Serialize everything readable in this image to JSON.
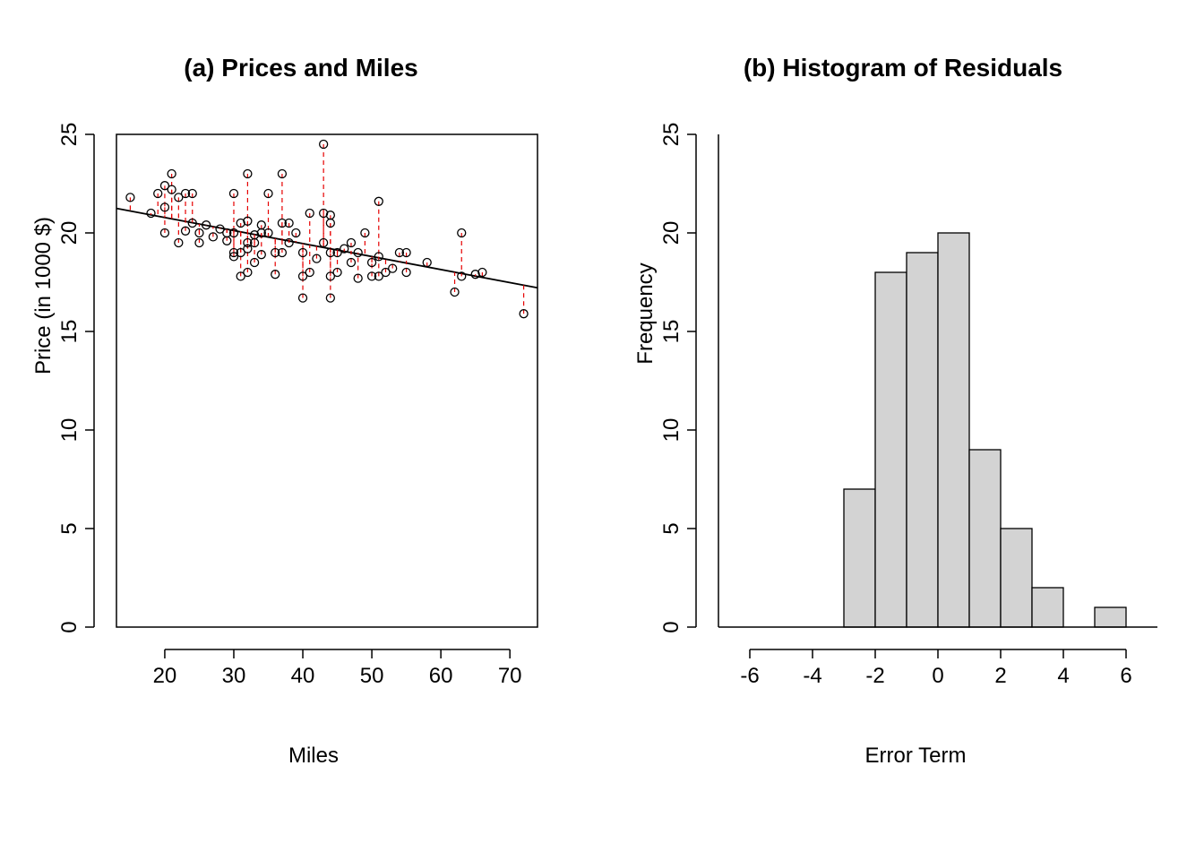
{
  "chart_data": [
    {
      "type": "scatter",
      "title": "(a) Prices and Miles",
      "xlabel": "Miles",
      "ylabel": "Price (in 1000 $)",
      "xlim": [
        13,
        74
      ],
      "ylim": [
        0,
        25
      ],
      "xticks": [
        20,
        30,
        40,
        50,
        60,
        70
      ],
      "yticks": [
        0,
        5,
        10,
        15,
        20,
        25
      ],
      "regression": {
        "slope": -0.066,
        "intercept": 22.1
      },
      "points": [
        {
          "x": 15,
          "y": 21.8
        },
        {
          "x": 18,
          "y": 21.0
        },
        {
          "x": 19,
          "y": 22.0
        },
        {
          "x": 20,
          "y": 22.4
        },
        {
          "x": 20,
          "y": 21.3
        },
        {
          "x": 20,
          "y": 20.0
        },
        {
          "x": 21,
          "y": 23.0
        },
        {
          "x": 21,
          "y": 22.2
        },
        {
          "x": 22,
          "y": 21.8
        },
        {
          "x": 22,
          "y": 19.5
        },
        {
          "x": 23,
          "y": 20.1
        },
        {
          "x": 23,
          "y": 22.0
        },
        {
          "x": 24,
          "y": 20.5
        },
        {
          "x": 24,
          "y": 22.0
        },
        {
          "x": 25,
          "y": 19.5
        },
        {
          "x": 25,
          "y": 20.0
        },
        {
          "x": 26,
          "y": 20.4
        },
        {
          "x": 27,
          "y": 19.8
        },
        {
          "x": 28,
          "y": 20.2
        },
        {
          "x": 29,
          "y": 19.6
        },
        {
          "x": 29,
          "y": 20.0
        },
        {
          "x": 30,
          "y": 18.8
        },
        {
          "x": 30,
          "y": 19.0
        },
        {
          "x": 30,
          "y": 20.0
        },
        {
          "x": 30,
          "y": 22.0
        },
        {
          "x": 31,
          "y": 17.8
        },
        {
          "x": 31,
          "y": 19.0
        },
        {
          "x": 31,
          "y": 20.5
        },
        {
          "x": 32,
          "y": 18.0
        },
        {
          "x": 32,
          "y": 19.2
        },
        {
          "x": 32,
          "y": 19.5
        },
        {
          "x": 32,
          "y": 20.6
        },
        {
          "x": 32,
          "y": 23.0
        },
        {
          "x": 33,
          "y": 18.5
        },
        {
          "x": 33,
          "y": 19.5
        },
        {
          "x": 33,
          "y": 19.9
        },
        {
          "x": 34,
          "y": 18.9
        },
        {
          "x": 34,
          "y": 20.0
        },
        {
          "x": 34,
          "y": 20.4
        },
        {
          "x": 35,
          "y": 20.0
        },
        {
          "x": 35,
          "y": 22.0
        },
        {
          "x": 36,
          "y": 19.0
        },
        {
          "x": 36,
          "y": 17.9
        },
        {
          "x": 37,
          "y": 23.0
        },
        {
          "x": 37,
          "y": 20.5
        },
        {
          "x": 37,
          "y": 19.0
        },
        {
          "x": 38,
          "y": 19.5
        },
        {
          "x": 38,
          "y": 20.5
        },
        {
          "x": 39,
          "y": 20.0
        },
        {
          "x": 40,
          "y": 16.7
        },
        {
          "x": 40,
          "y": 17.8
        },
        {
          "x": 40,
          "y": 19.0
        },
        {
          "x": 41,
          "y": 18.0
        },
        {
          "x": 41,
          "y": 21.0
        },
        {
          "x": 42,
          "y": 18.7
        },
        {
          "x": 43,
          "y": 19.5
        },
        {
          "x": 43,
          "y": 21.0
        },
        {
          "x": 43,
          "y": 24.5
        },
        {
          "x": 44,
          "y": 16.7
        },
        {
          "x": 44,
          "y": 17.8
        },
        {
          "x": 44,
          "y": 19.0
        },
        {
          "x": 44,
          "y": 20.5
        },
        {
          "x": 44,
          "y": 20.9
        },
        {
          "x": 45,
          "y": 18.0
        },
        {
          "x": 45,
          "y": 19.0
        },
        {
          "x": 46,
          "y": 19.2
        },
        {
          "x": 47,
          "y": 18.5
        },
        {
          "x": 47,
          "y": 19.5
        },
        {
          "x": 48,
          "y": 17.7
        },
        {
          "x": 48,
          "y": 19.0
        },
        {
          "x": 49,
          "y": 20.0
        },
        {
          "x": 50,
          "y": 17.8
        },
        {
          "x": 50,
          "y": 18.5
        },
        {
          "x": 51,
          "y": 17.8
        },
        {
          "x": 51,
          "y": 18.8
        },
        {
          "x": 51,
          "y": 21.6
        },
        {
          "x": 52,
          "y": 18.0
        },
        {
          "x": 53,
          "y": 18.2
        },
        {
          "x": 54,
          "y": 19.0
        },
        {
          "x": 55,
          "y": 18.0
        },
        {
          "x": 55,
          "y": 19.0
        },
        {
          "x": 58,
          "y": 18.5
        },
        {
          "x": 62,
          "y": 17.0
        },
        {
          "x": 63,
          "y": 17.8
        },
        {
          "x": 63,
          "y": 20.0
        },
        {
          "x": 65,
          "y": 17.9
        },
        {
          "x": 66,
          "y": 18.0
        },
        {
          "x": 72,
          "y": 15.9
        }
      ]
    },
    {
      "type": "bar",
      "title": "(b) Histogram of Residuals",
      "xlabel": "Error Term",
      "ylabel": "Frequency",
      "xlim": [
        -7,
        7
      ],
      "ylim": [
        0,
        25
      ],
      "xticks": [
        -6,
        -4,
        -2,
        0,
        2,
        4,
        6
      ],
      "yticks": [
        0,
        5,
        10,
        15,
        20,
        25
      ],
      "bins": [
        {
          "from": -3,
          "to": -2,
          "count": 7
        },
        {
          "from": -2,
          "to": -1,
          "count": 18
        },
        {
          "from": -1,
          "to": 0,
          "count": 19
        },
        {
          "from": 0,
          "to": 1,
          "count": 20
        },
        {
          "from": 1,
          "to": 2,
          "count": 9
        },
        {
          "from": 2,
          "to": 3,
          "count": 5
        },
        {
          "from": 3,
          "to": 4,
          "count": 2
        },
        {
          "from": 4,
          "to": 5,
          "count": 0
        },
        {
          "from": 5,
          "to": 6,
          "count": 1
        }
      ]
    }
  ]
}
